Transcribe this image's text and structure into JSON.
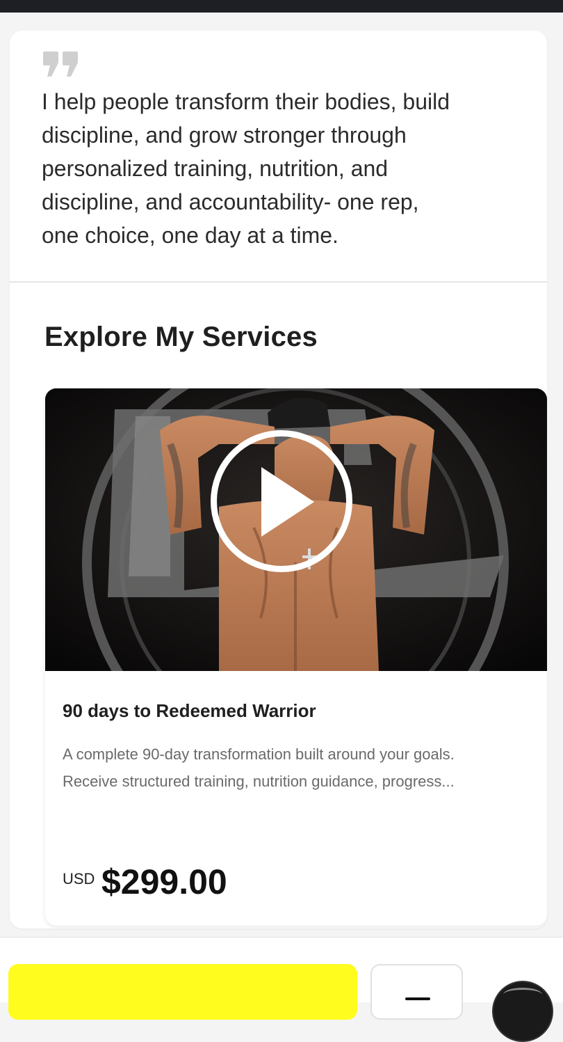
{
  "bio": {
    "quote_icon": "quote-icon",
    "lines": [
      "I help people transform their bodies, build",
      "discipline, and grow stronger through",
      "personalized training, nutrition, and",
      "discipline, and accountability- one rep,",
      "one choice, one day at a time."
    ]
  },
  "services": {
    "title": "Explore My Services",
    "items": [
      {
        "name": "90 days to Redeemed Warrior",
        "description_lines": [
          "A complete 90-day transformation built around your goals.",
          "Receive structured training, nutrition guidance, progress..."
        ],
        "currency": "USD",
        "price": "$299.00",
        "media_icon": "play-icon"
      }
    ]
  },
  "bottom_bar": {
    "cta_color": "#fffc1e",
    "menu_icon": "menu-icon",
    "avatar": "avatar"
  }
}
